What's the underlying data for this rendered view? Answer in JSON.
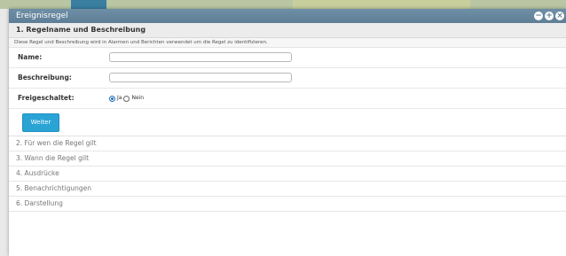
{
  "window": {
    "title": "Ereignisregel",
    "controls": [
      "minus-icon",
      "plus-icon",
      "close-icon"
    ]
  },
  "section1": {
    "heading": "1. Regelname und Beschreibung",
    "description": "Diese Regel und Beschreibung wird in Alarmen und Berichten verwendet um die Regel zu identifizieren."
  },
  "form": {
    "name_label": "Name:",
    "name_value": "",
    "description_label": "Beschreibung:",
    "description_value": "",
    "enabled_label": "Freigeschaltet:",
    "enabled_options": [
      {
        "label": "Ja",
        "selected": true
      },
      {
        "label": "Nein",
        "selected": false
      }
    ],
    "next_button": "Weiter"
  },
  "steps": [
    "2. Für wen die Regel gilt",
    "3. Wann die Regel gilt",
    "4. Ausdrücke",
    "5. Benachrichtigungen",
    "6. Darstellung"
  ],
  "colors": {
    "titlebar": "#5e7f97",
    "button": "#2aa3d5"
  }
}
